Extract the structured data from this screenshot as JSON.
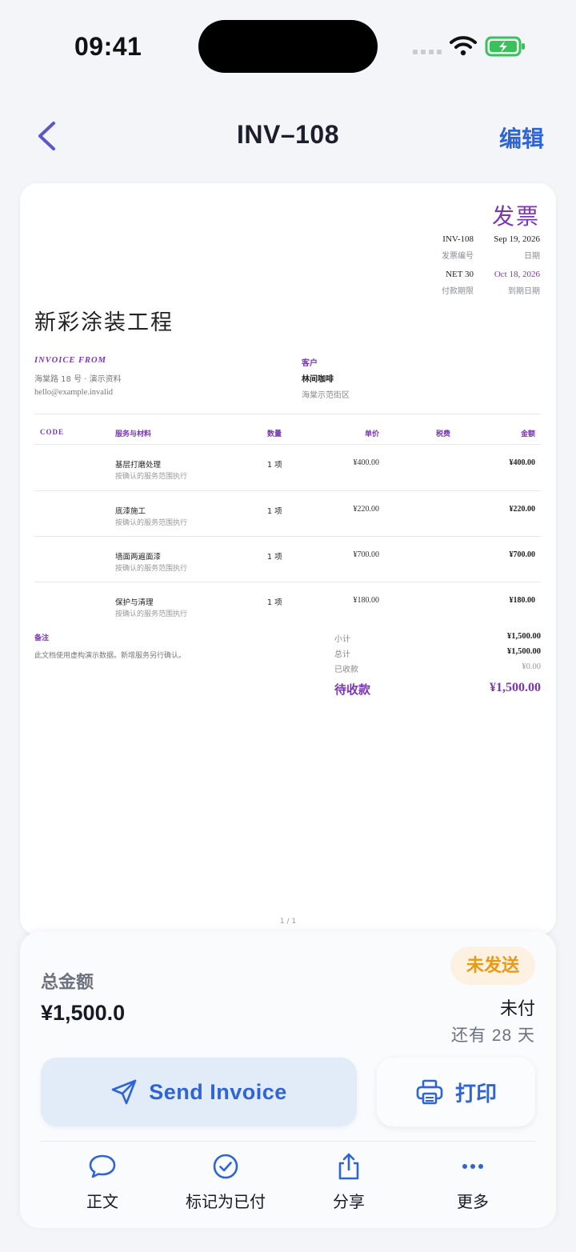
{
  "status_bar": {
    "time": "09:41"
  },
  "nav": {
    "title": "INV–108",
    "edit_label": "编辑"
  },
  "invoice": {
    "doc_title": "发票",
    "meta": {
      "number_value": "INV-108",
      "number_label": "发票编号",
      "date_value": "Sep 19, 2026",
      "date_label": "日期",
      "terms_value": "NET 30",
      "terms_label": "付款期限",
      "due_value": "Oct 18, 2026",
      "due_label": "到期日期"
    },
    "project_title": "新彩涂装工程",
    "from": {
      "heading": "INVOICE FROM",
      "address": "海棠路 18 号 · 演示资料",
      "email": "hello@example.invalid"
    },
    "to": {
      "heading": "客户",
      "name": "林间咖啡",
      "address": "海棠示范街区"
    },
    "columns": {
      "code": "CODE",
      "desc": "服务与材料",
      "qty": "数量",
      "unit": "单价",
      "tax": "税费",
      "amount": "金额"
    },
    "items": [
      {
        "name": "基层打磨处理",
        "sub": "按确认的服务范围执行",
        "qty": "1 项",
        "unit": "¥400.00",
        "amount": "¥400.00"
      },
      {
        "name": "底漆施工",
        "sub": "按确认的服务范围执行",
        "qty": "1 项",
        "unit": "¥220.00",
        "amount": "¥220.00"
      },
      {
        "name": "墙面两遍面漆",
        "sub": "按确认的服务范围执行",
        "qty": "1 项",
        "unit": "¥700.00",
        "amount": "¥700.00"
      },
      {
        "name": "保护与清理",
        "sub": "按确认的服务范围执行",
        "qty": "1 项",
        "unit": "¥180.00",
        "amount": "¥180.00"
      }
    ],
    "notes": {
      "heading": "备注",
      "text": "此文档使用虚构演示数据。新增服务另行确认。"
    },
    "totals": {
      "subtotal_label": "小计",
      "subtotal_value": "¥1,500.00",
      "total_label": "总计",
      "total_value": "¥1,500.00",
      "received_label": "已收款",
      "received_value": "¥0.00",
      "due_label": "待收款",
      "due_value": "¥1,500.00"
    },
    "page_number": "1 / 1"
  },
  "summary": {
    "total_label": "总金额",
    "total_value": "¥1,500.0",
    "badge": "未发送",
    "payment_status": "未付",
    "days_left": "还有 28 天"
  },
  "actions": {
    "send_label": "Send Invoice",
    "print_label": "打印"
  },
  "tabbar": [
    {
      "label": "正文",
      "icon": "speech-bubble-icon"
    },
    {
      "label": "标记为已付",
      "icon": "check-circle-icon"
    },
    {
      "label": "分享",
      "icon": "share-icon"
    },
    {
      "label": "更多",
      "icon": "ellipsis-icon"
    }
  ],
  "colors": {
    "accent": "#2e64d6",
    "invoice_purple": "#7b36b5",
    "badge_orange": "#e89a16"
  }
}
